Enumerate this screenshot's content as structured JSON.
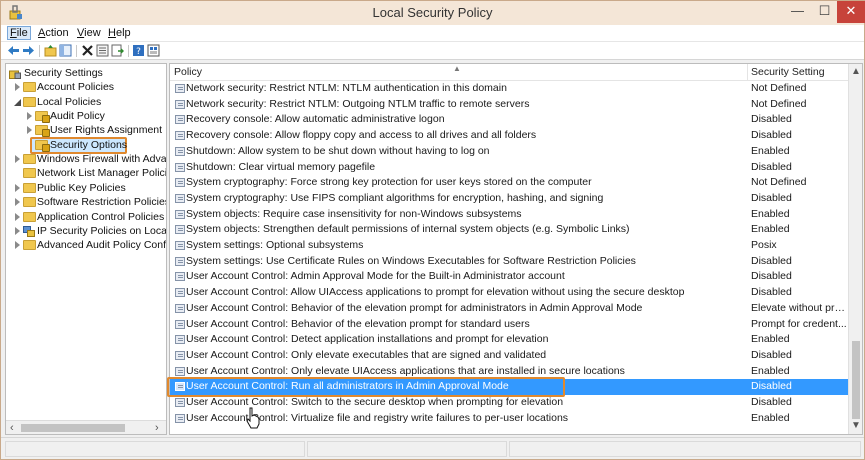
{
  "window": {
    "title": "Local Security Policy",
    "controls": {
      "minimize": "—",
      "maximize": "☐",
      "close": "✕"
    }
  },
  "menubar": {
    "items": [
      {
        "label": "File"
      },
      {
        "label": "Action"
      },
      {
        "label": "View"
      },
      {
        "label": "Help"
      }
    ]
  },
  "toolbar": {
    "icons": [
      "back-icon",
      "forward-icon",
      "up-folder-icon",
      "show-hide-tree-icon",
      "delete-icon",
      "properties-icon",
      "export-list-icon",
      "help-icon",
      "view-icon"
    ]
  },
  "tree": {
    "items": [
      {
        "label": "Security Settings",
        "icon": "security-settings-icon"
      },
      {
        "label": "Account Policies",
        "icon": "folder-icon"
      },
      {
        "label": "Local Policies",
        "icon": "folder-icon"
      },
      {
        "label": "Audit Policy",
        "icon": "folder-lock-icon"
      },
      {
        "label": "User Rights Assignment",
        "icon": "folder-lock-icon"
      },
      {
        "label": "Security Options",
        "icon": "folder-lock-icon"
      },
      {
        "label": "Windows Firewall with Advanc",
        "icon": "folder-icon"
      },
      {
        "label": "Network List Manager Policies",
        "icon": "folder-icon"
      },
      {
        "label": "Public Key Policies",
        "icon": "folder-icon"
      },
      {
        "label": "Software Restriction Policies",
        "icon": "folder-icon"
      },
      {
        "label": "Application Control Policies",
        "icon": "folder-icon"
      },
      {
        "label": "IP Security Policies on Local Cc",
        "icon": "ip-security-icon"
      },
      {
        "label": "Advanced Audit Policy Config",
        "icon": "folder-icon"
      }
    ]
  },
  "list": {
    "columns": {
      "policy": "Policy",
      "setting": "Security Setting"
    },
    "rows": [
      {
        "policy": "Network security: Restrict NTLM: NTLM authentication in this domain",
        "setting": "Not Defined"
      },
      {
        "policy": "Network security: Restrict NTLM: Outgoing NTLM traffic to remote servers",
        "setting": "Not Defined"
      },
      {
        "policy": "Recovery console: Allow automatic administrative logon",
        "setting": "Disabled"
      },
      {
        "policy": "Recovery console: Allow floppy copy and access to all drives and all folders",
        "setting": "Disabled"
      },
      {
        "policy": "Shutdown: Allow system to be shut down without having to log on",
        "setting": "Enabled"
      },
      {
        "policy": "Shutdown: Clear virtual memory pagefile",
        "setting": "Disabled"
      },
      {
        "policy": "System cryptography: Force strong key protection for user keys stored on the computer",
        "setting": "Not Defined"
      },
      {
        "policy": "System cryptography: Use FIPS compliant algorithms for encryption, hashing, and signing",
        "setting": "Disabled"
      },
      {
        "policy": "System objects: Require case insensitivity for non-Windows subsystems",
        "setting": "Enabled"
      },
      {
        "policy": "System objects: Strengthen default permissions of internal system objects (e.g. Symbolic Links)",
        "setting": "Enabled"
      },
      {
        "policy": "System settings: Optional subsystems",
        "setting": "Posix"
      },
      {
        "policy": "System settings: Use Certificate Rules on Windows Executables for Software Restriction Policies",
        "setting": "Disabled"
      },
      {
        "policy": "User Account Control: Admin Approval Mode for the Built-in Administrator account",
        "setting": "Disabled"
      },
      {
        "policy": "User Account Control: Allow UIAccess applications to prompt for elevation without using the secure desktop",
        "setting": "Disabled"
      },
      {
        "policy": "User Account Control: Behavior of the elevation prompt for administrators in Admin Approval Mode",
        "setting": "Elevate without pro..."
      },
      {
        "policy": "User Account Control: Behavior of the elevation prompt for standard users",
        "setting": "Prompt for credent..."
      },
      {
        "policy": "User Account Control: Detect application installations and prompt for elevation",
        "setting": "Enabled"
      },
      {
        "policy": "User Account Control: Only elevate executables that are signed and validated",
        "setting": "Disabled"
      },
      {
        "policy": "User Account Control: Only elevate UIAccess applications that are installed in secure locations",
        "setting": "Enabled"
      },
      {
        "policy": "User Account Control: Run all administrators in Admin Approval Mode",
        "setting": "Disabled"
      },
      {
        "policy": "User Account Control: Switch to the secure desktop when prompting for elevation",
        "setting": "Disabled"
      },
      {
        "policy": "User Account Control: Virtualize file and registry write failures to per-user locations",
        "setting": "Enabled"
      }
    ]
  },
  "colors": {
    "selection": "#3399ff",
    "highlight_outline": "#e0892e",
    "titlebar": "#f4e6d7",
    "close_button": "#c7433a"
  }
}
